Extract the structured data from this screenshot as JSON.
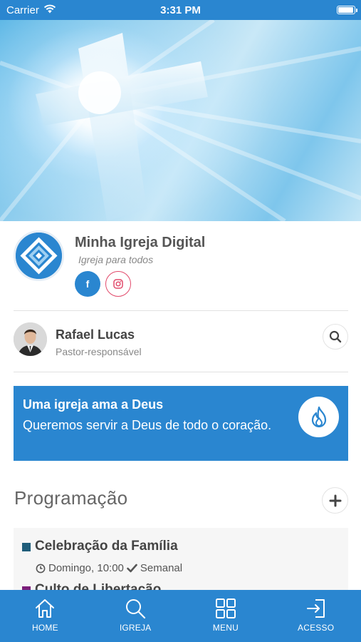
{
  "status_bar": {
    "carrier": "Carrier",
    "time": "3:31 PM",
    "battery_level": 0.95
  },
  "profile": {
    "name": "Minha Igreja Digital",
    "tagline": "Igreja para todos",
    "facebook_label": "f"
  },
  "pastor": {
    "name": "Rafael Lucas",
    "role": "Pastor-responsável"
  },
  "banner": {
    "title": "Uma igreja ama a Deus",
    "text": "Queremos servir a Deus de todo o coração."
  },
  "schedule": {
    "title": "Programação",
    "events": [
      {
        "title": "Celebração da Família",
        "day_time": "Domingo, 10:00",
        "frequency": "Semanal",
        "color": "#1f5d7a"
      },
      {
        "title": "Culto de Libertação",
        "color": "#7b1e7a"
      }
    ]
  },
  "tabbar": {
    "items": [
      {
        "label": "HOME",
        "icon": "home-icon"
      },
      {
        "label": "IGREJA",
        "icon": "search-icon"
      },
      {
        "label": "MENU",
        "icon": "grid-icon"
      },
      {
        "label": "ACESSO",
        "icon": "login-icon"
      }
    ]
  },
  "colors": {
    "primary": "#2a86d0",
    "instagram": "#e24a6b"
  }
}
